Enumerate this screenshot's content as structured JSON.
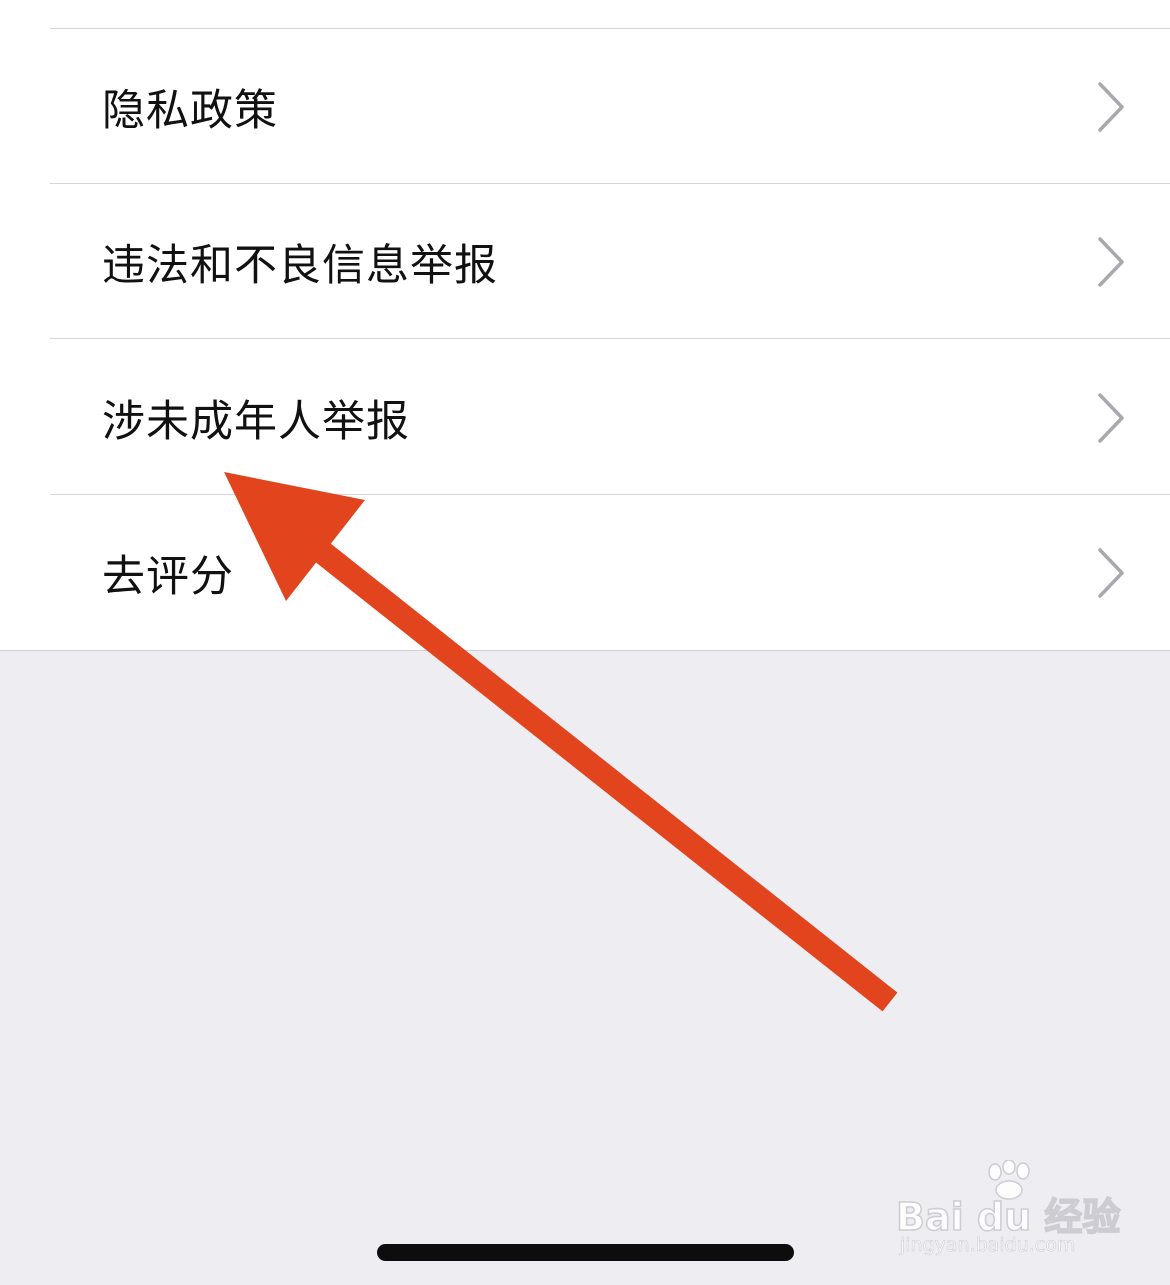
{
  "settings": {
    "items": [
      {
        "label": "隐私政策"
      },
      {
        "label": "违法和不良信息举报"
      },
      {
        "label": "涉未成年人举报"
      },
      {
        "label": "去评分"
      }
    ]
  },
  "annotation": {
    "arrow_color": "#e2441e",
    "target": "涉未成年人举报"
  },
  "watermark": {
    "logo_text": "Bai du 经验",
    "url": "jingyan.baidu.com"
  },
  "icons": {
    "chevron": "chevron-right-icon",
    "paw": "baidu-paw-icon"
  },
  "colors": {
    "list_background": "#ffffff",
    "page_background": "#eeedf2",
    "divider": "#d6d6da",
    "chevron": "#a8a8ad",
    "text": "#111111"
  }
}
